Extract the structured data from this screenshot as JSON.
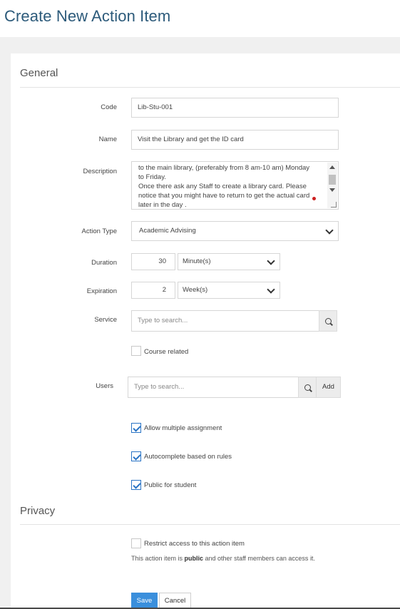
{
  "page_title": "Create New Action Item",
  "sections": {
    "general": "General",
    "privacy": "Privacy"
  },
  "fields": {
    "code": {
      "label": "Code",
      "value": "Lib-Stu-001"
    },
    "name": {
      "label": "Name",
      "value": "Visit the Library and get the ID card"
    },
    "description": {
      "label": "Description",
      "lines": [
        "to the main library, (preferably from 8 am-10 am) Monday",
        "to Friday.",
        "Once there ask any Staff to create a library card. Please",
        "notice that you might have to return to get the actual card",
        "later in the day ."
      ]
    },
    "action_type": {
      "label": "Action Type",
      "value": "Academic Advising"
    },
    "duration": {
      "label": "Duration",
      "value": "30",
      "unit": "Minute(s)"
    },
    "expiration": {
      "label": "Expiration",
      "value": "2",
      "unit": "Week(s)"
    },
    "service": {
      "label": "Service",
      "placeholder": "Type to search..."
    },
    "course_related": {
      "label": "Course related",
      "checked": false
    },
    "users": {
      "label": "Users",
      "placeholder": "Type to search...",
      "add_label": "Add"
    },
    "allow_multiple": {
      "label": "Allow multiple assignment",
      "checked": true
    },
    "autocomplete": {
      "label": "Autocomplete based on rules",
      "checked": true
    },
    "public_student": {
      "label": "Public for student",
      "checked": true
    }
  },
  "privacy": {
    "restrict": {
      "label": "Restrict access to this action item",
      "checked": false
    },
    "note_prefix": "This action item is ",
    "note_bold": "public",
    "note_suffix": " and other staff members can access it."
  },
  "buttons": {
    "save": "Save",
    "cancel": "Cancel"
  },
  "colors": {
    "title": "#2c5a7a",
    "primary": "#3a8fdc",
    "check": "#2a74c5"
  },
  "icons": [
    "search-icon",
    "chevron-down-icon",
    "check-icon"
  ]
}
